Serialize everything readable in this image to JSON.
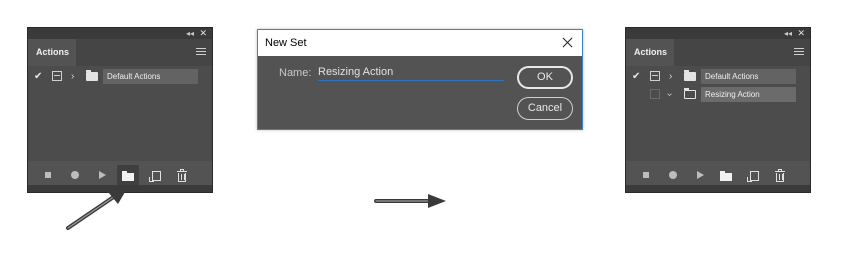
{
  "left_panel": {
    "tab_label": "Actions",
    "rows": [
      {
        "name": "Default Actions",
        "checked": true,
        "expanded": false
      }
    ],
    "bottom_buttons": [
      "stop-icon",
      "record-icon",
      "play-icon",
      "new-set-icon",
      "new-action-icon",
      "delete-icon"
    ],
    "active_button": "new-set-icon"
  },
  "dialog": {
    "title": "New Set",
    "name_label": "Name:",
    "name_value": "Resizing Action",
    "ok_label": "OK",
    "cancel_label": "Cancel"
  },
  "right_panel": {
    "tab_label": "Actions",
    "rows": [
      {
        "name": "Default Actions",
        "checked": true,
        "expanded": false
      },
      {
        "name": "Resizing Action",
        "checked": false,
        "expanded": true,
        "selected": true
      }
    ],
    "bottom_buttons": [
      "stop-icon",
      "record-icon",
      "play-icon",
      "new-set-icon",
      "new-action-icon",
      "delete-icon"
    ]
  },
  "colors": {
    "panel_bg": "#535353",
    "dialog_accent": "#3c84c8",
    "arrow": "#333333"
  }
}
